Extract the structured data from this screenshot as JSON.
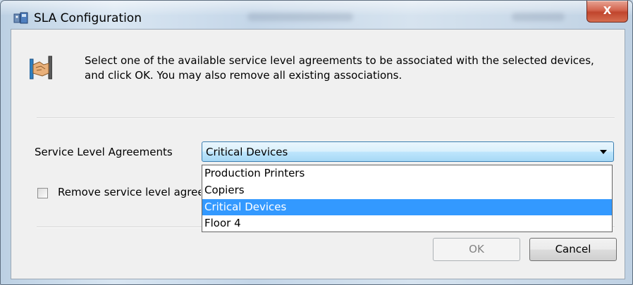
{
  "window": {
    "title": "SLA Configuration",
    "close_label": "X"
  },
  "description": "Select one of the available service level agreements to be associated with the selected devices, and click OK.  You may also remove all existing associations.",
  "sla": {
    "label": "Service Level Agreements",
    "selected": "Critical Devices",
    "options": [
      "Production Printers",
      "Copiers",
      "Critical Devices",
      "Floor 4"
    ]
  },
  "remove": {
    "label": "Remove service level agreement associations",
    "checked": false
  },
  "buttons": {
    "ok": "OK",
    "cancel": "Cancel"
  },
  "colors": {
    "selection": "#3399ff",
    "close_button": "#c0452d"
  }
}
